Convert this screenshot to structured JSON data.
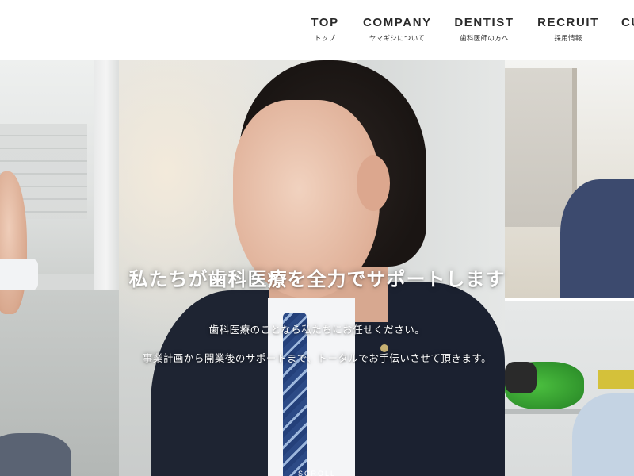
{
  "nav": {
    "items": [
      {
        "en": "TOP",
        "ja": "トップ"
      },
      {
        "en": "COMPANY",
        "ja": "ヤマギシについて"
      },
      {
        "en": "DENTIST",
        "ja": "歯科医師の方へ"
      },
      {
        "en": "RECRUIT",
        "ja": "採用情報"
      },
      {
        "en": "CU",
        "ja": ""
      }
    ]
  },
  "hero": {
    "heading": "私たちが歯科医療を全力でサポートします",
    "lines": [
      "歯科医療のことなら私たちにお任せください。",
      "事業計画から開業後のサポートまで、トータルでお手伝いさせて頂きます。"
    ],
    "scroll_label": "SCROLL"
  }
}
